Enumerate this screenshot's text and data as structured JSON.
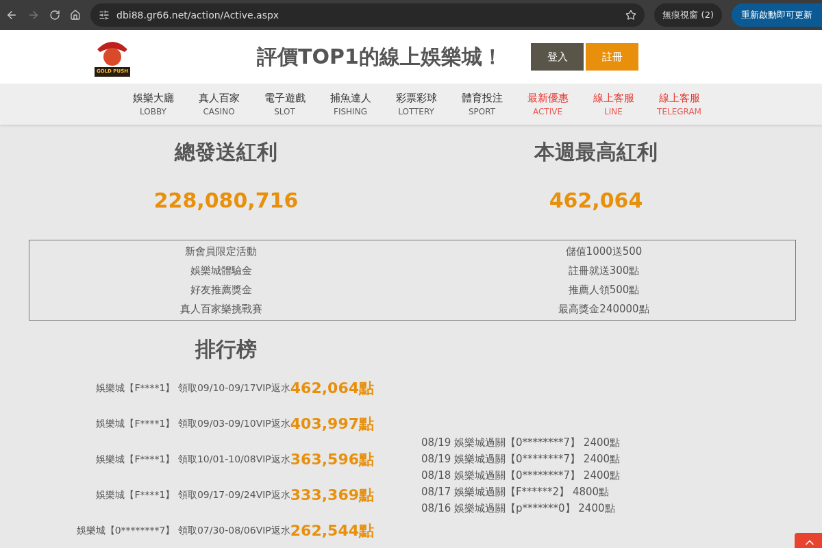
{
  "browser": {
    "url": "dbi88.gr66.net/action/Active.aspx",
    "profile": "無痕視窗 (2)",
    "update": "重新啟動即可更新"
  },
  "header": {
    "logo": "GOLD PUSH",
    "slogan": "評價TOP1的線上娛樂城！",
    "login": "登入",
    "register": "註冊"
  },
  "nav": [
    {
      "label": "娛樂大廳",
      "sub": "LOBBY",
      "highlighted": false
    },
    {
      "label": "真人百家",
      "sub": "CASINO",
      "highlighted": false
    },
    {
      "label": "電子遊戲",
      "sub": "SLOT",
      "highlighted": false
    },
    {
      "label": "捕魚達人",
      "sub": "FISHING",
      "highlighted": false
    },
    {
      "label": "彩票彩球",
      "sub": "LOTTERY",
      "highlighted": false
    },
    {
      "label": "體育投注",
      "sub": "SPORT",
      "highlighted": false
    },
    {
      "label": "最新優惠",
      "sub": "ACTIVE",
      "highlighted": true
    },
    {
      "label": "線上客服",
      "sub": "LINE",
      "highlighted": true
    },
    {
      "label": "線上客服",
      "sub": "TELEGRAM",
      "highlighted": true
    }
  ],
  "stats": [
    {
      "title": "總發送紅利",
      "value": "228,080,716"
    },
    {
      "title": "本週最高紅利",
      "value": "462,064"
    }
  ],
  "promotions": [
    {
      "name": "新會員限定活動",
      "reward": "儲值1000送500"
    },
    {
      "name": "娛樂城體驗金",
      "reward": "註冊就送300點"
    },
    {
      "name": "好友推薦獎金",
      "reward": "推薦人領500點"
    },
    {
      "name": "真人百家樂挑戰賽",
      "reward": "最高獎金240000點"
    }
  ],
  "ranking": {
    "title": "排行榜",
    "rows": [
      {
        "text": "娛樂城【F****1】 領取09/10-09/17VIP返水",
        "amount": "462,064點"
      },
      {
        "text": "娛樂城【F****1】 領取09/03-09/10VIP返水",
        "amount": "403,997點"
      },
      {
        "text": "娛樂城【F****1】 領取10/01-10/08VIP返水",
        "amount": "363,596點"
      },
      {
        "text": "娛樂城【F****1】 領取09/17-09/24VIP返水",
        "amount": "333,369點"
      },
      {
        "text": "娛樂城【0********7】 領取07/30-08/06VIP返水",
        "amount": "262,544點"
      }
    ]
  },
  "winners": [
    "08/19 娛樂城過關【0********7】 2400點",
    "08/19 娛樂城過關【0********7】 2400點",
    "08/18 娛樂城過關【0********7】 2400點",
    "08/17 娛樂城過關【F******2】 4800點",
    "08/16 娛樂城過關【p*******0】 2400點"
  ]
}
